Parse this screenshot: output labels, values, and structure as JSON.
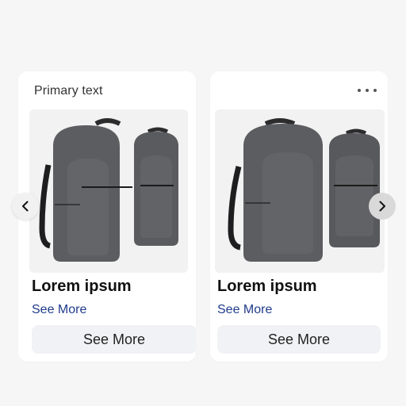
{
  "carousel": {
    "cards": [
      {
        "header_text": "Primary text",
        "title": "Lorem ipsum",
        "link_label": "See More",
        "button_label": "See More",
        "image_icon": "backpack-image"
      },
      {
        "title": "Lorem ipsum",
        "link_label": "See More",
        "button_label": "See More",
        "image_icon": "backpack-image",
        "menu_icon": "more-horizontal-icon"
      }
    ],
    "prev_icon": "chevron-left-icon",
    "next_icon": "chevron-right-icon"
  },
  "colors": {
    "background": "#f6f6f6",
    "card": "#ffffff",
    "link": "#1f3b8a",
    "button_bg": "#f1f2f5",
    "backpack": "#5a5b5e"
  }
}
